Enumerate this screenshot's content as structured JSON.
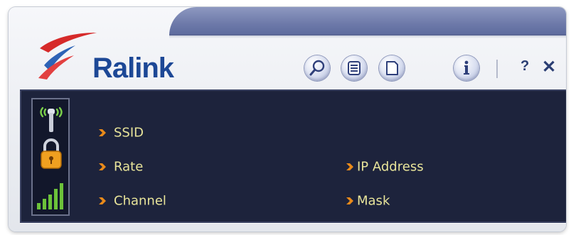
{
  "app": {
    "brand": "Ralink"
  },
  "toolbar": {
    "buttons": [
      {
        "icon": "magnifier-icon"
      },
      {
        "icon": "list-icon"
      },
      {
        "icon": "page-icon"
      },
      {
        "icon": "info-icon"
      }
    ],
    "help_label": "?",
    "close_label": "✕"
  },
  "status": {
    "signal_bars": 5,
    "icons": [
      "antenna-icon",
      "lock-icon",
      "signal-strength-icon"
    ]
  },
  "info": {
    "ssid_label": "SSID",
    "rate_label": "Rate",
    "channel_label": "Channel",
    "ip_label": "IP Address",
    "mask_label": "Mask"
  },
  "colors": {
    "panel_bg": "#1d233c",
    "label_text": "#e8e49a",
    "bullet": "#e98a1a",
    "brand_blue": "#1d4896",
    "signal_green": "#6cc23a"
  }
}
